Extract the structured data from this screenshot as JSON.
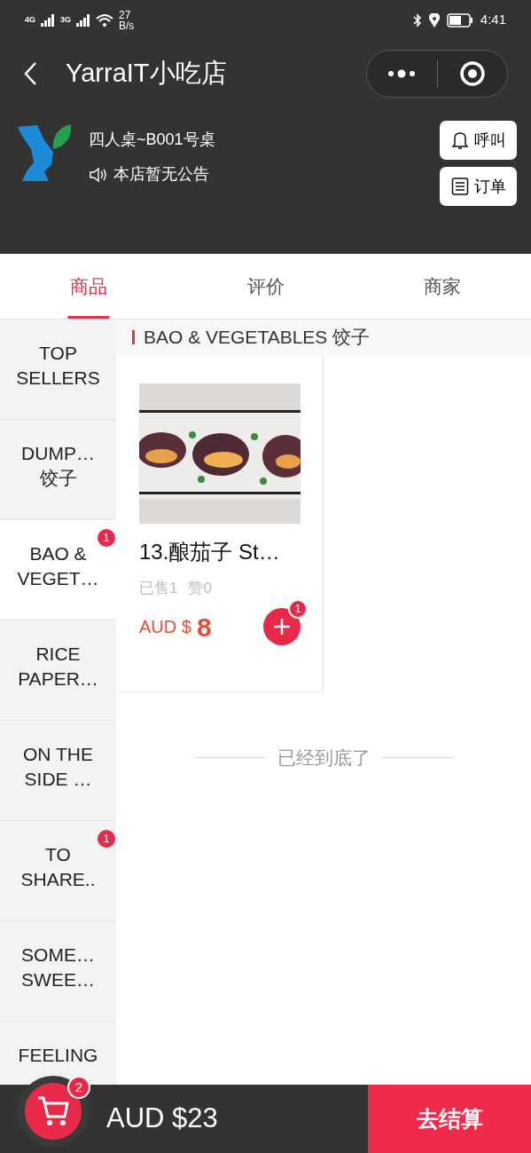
{
  "status_bar": {
    "network_1": "4G",
    "network_2": "3G",
    "speed_value": "27",
    "speed_unit": "B/s",
    "time": "4:41"
  },
  "nav": {
    "title": "YarraIT小吃店"
  },
  "shop": {
    "table": "四人桌~B001号桌",
    "notice": "本店暂无公告",
    "buttons": [
      {
        "kind": "bell",
        "label": "呼叫"
      },
      {
        "kind": "list",
        "label": "订单"
      }
    ]
  },
  "tabs": [
    {
      "label": "商品",
      "selected": true
    },
    {
      "label": "评价",
      "selected": false
    },
    {
      "label": "商家",
      "selected": false
    }
  ],
  "categories": [
    {
      "lines": [
        "TOP",
        "SELLERS"
      ],
      "selected": false
    },
    {
      "lines": [
        "DUMP…",
        "饺子"
      ],
      "selected": false
    },
    {
      "lines": [
        "BAO &",
        "VEGET…"
      ],
      "selected": true,
      "badge": "1"
    },
    {
      "lines": [
        "RICE",
        "PAPER…"
      ],
      "selected": false
    },
    {
      "lines": [
        "ON THE",
        "SIDE …"
      ],
      "selected": false
    },
    {
      "lines": [
        "TO",
        "SHARE.."
      ],
      "selected": false,
      "badge": "1"
    },
    {
      "lines": [
        "SOME…",
        "SWEE…"
      ],
      "selected": false
    },
    {
      "lines": [
        "FEELING"
      ],
      "selected": false
    }
  ],
  "section_title": "BAO & VEGETABLES 饺子",
  "products": [
    {
      "kind": "picture",
      "name": "13.酿茄子 St…",
      "sold": "已售1",
      "likes": "赞0",
      "currency": "AUD $",
      "price": "8",
      "count": "1"
    }
  ],
  "end_text": "已经到底了",
  "cart": {
    "count": "2",
    "total": "AUD $23",
    "checkout": "去结算"
  }
}
